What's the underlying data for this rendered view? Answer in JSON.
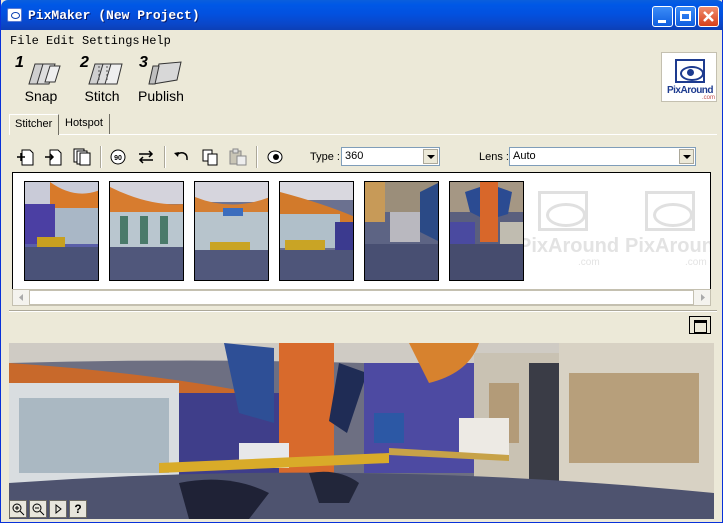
{
  "window": {
    "title": "PixMaker (New Project)"
  },
  "menu": [
    "File",
    "Edit",
    "Settings",
    "Help"
  ],
  "steps": [
    {
      "num": "1",
      "label": "Snap"
    },
    {
      "num": "2",
      "label": "Stitch"
    },
    {
      "num": "3",
      "label": "Publish"
    }
  ],
  "logo": {
    "text": "PixAround",
    "suffix": ".com"
  },
  "tabs": [
    "Stitcher",
    "Hotspot"
  ],
  "stitcher": {
    "type_label": "Type :",
    "type_value": "360",
    "lens_label": "Lens :",
    "lens_value": "Auto"
  },
  "watermark": {
    "text": "PixAround",
    "suffix": ".com"
  },
  "pano_controls": {
    "help": "?"
  }
}
